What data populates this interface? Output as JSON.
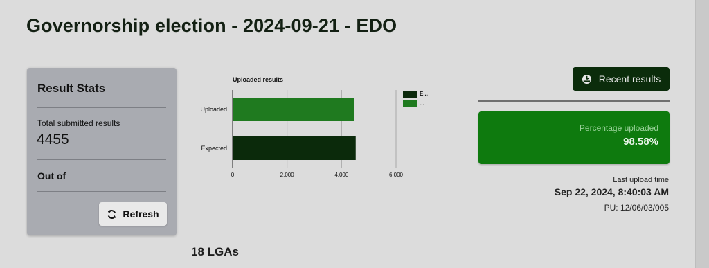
{
  "page": {
    "title": "Governorship election - 2024-09-21 - EDO"
  },
  "stats": {
    "title": "Result Stats",
    "total_label": "Total submitted results",
    "total_value": "4455",
    "out_of_label": "Out of",
    "refresh_label": "Refresh"
  },
  "chart_data": {
    "type": "bar",
    "orientation": "horizontal",
    "title": "Uploaded results",
    "categories": [
      "Uploaded",
      "Expected"
    ],
    "series": [
      {
        "name": "E...",
        "values": [
          4455,
          4519
        ],
        "color": "#0b2a0b"
      },
      {
        "name": "...",
        "values": [
          null,
          null
        ],
        "color": "#1f7a1f"
      }
    ],
    "bar_colors": [
      "#1f7a1f",
      "#0b2a0b"
    ],
    "xticks": [
      "0",
      "2,000",
      "4,000",
      "6,000"
    ],
    "xlim": [
      0,
      6000
    ],
    "grid": true,
    "legend": "right"
  },
  "right_panel": {
    "recent_button_label": "Recent results",
    "percent_label": "Percentage uploaded",
    "percent_value": "98.58%",
    "last_upload_label": "Last upload time",
    "last_upload_time": "Sep 22, 2024, 8:40:03 AM",
    "pu_code": "PU: 12/06/03/005"
  },
  "footer": {
    "lga_count": "18 LGAs"
  },
  "colors": {
    "dark_green": "#0b2c0b",
    "accent_green": "#0e7a0e",
    "card_gray": "#a9abb1",
    "background": "#dcdcdc"
  }
}
